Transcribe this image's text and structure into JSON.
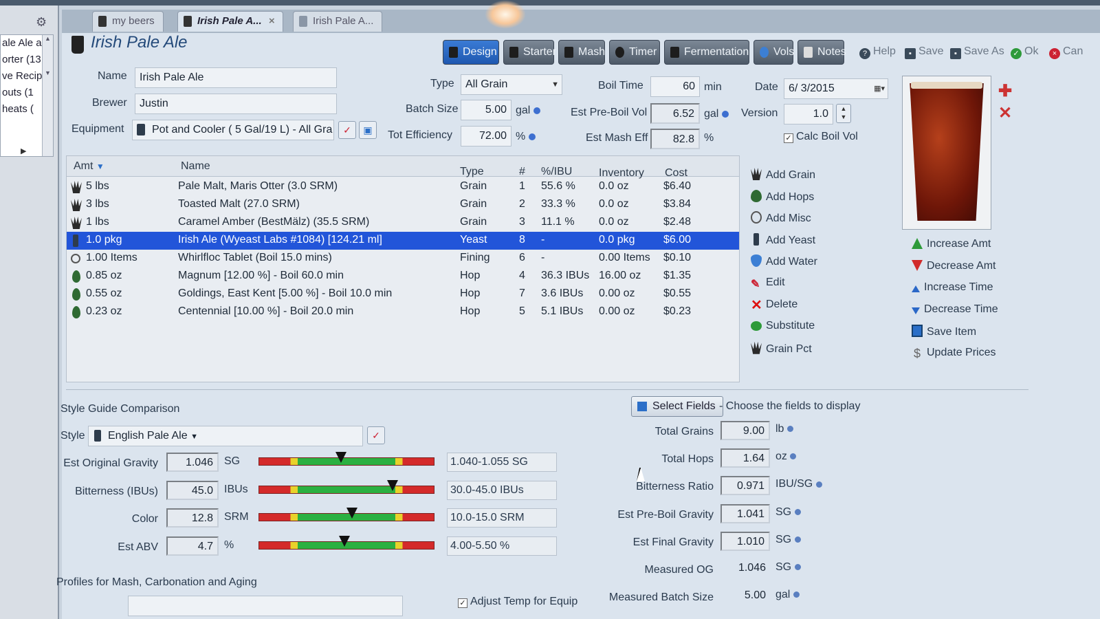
{
  "left_tree": {
    "items": [
      "ale Ale a",
      "orter (13",
      "ve Recip",
      "outs (1",
      "heats ("
    ]
  },
  "tabs": [
    {
      "label": "my beers",
      "active": false
    },
    {
      "label": "Irish Pale A...",
      "active": true,
      "close": "×"
    },
    {
      "label": "Irish Pale A...",
      "active": false
    }
  ],
  "title": "Irish Pale Ale",
  "toolbar": {
    "buttons": [
      "Design",
      "Starter",
      "Mash",
      "Timer",
      "Fermentation",
      "Vols",
      "Notes"
    ],
    "right": [
      "Help",
      "Save",
      "Save As",
      "Ok",
      "Can"
    ]
  },
  "recipe": {
    "name_label": "Name",
    "name": "Irish Pale Ale",
    "brewer_label": "Brewer",
    "brewer": "Justin",
    "equipment_label": "Equipment",
    "equipment": "Pot and Cooler ( 5 Gal/19 L) - All Gra",
    "type_label": "Type",
    "type": "All Grain",
    "batch_label": "Batch Size",
    "batch": "5.00",
    "batch_unit": "gal",
    "eff_label": "Tot Efficiency",
    "eff": "72.00",
    "eff_unit": "%",
    "boil_label": "Boil Time",
    "boil": "60",
    "boil_unit": "min",
    "preboil_label": "Est Pre-Boil Vol",
    "preboil": "6.52",
    "preboil_unit": "gal",
    "masheff_label": "Est Mash Eff",
    "masheff": "82.8",
    "masheff_unit": "%",
    "date_label": "Date",
    "date": "6/ 3/2015",
    "version_label": "Version",
    "version": "1.0",
    "calc_label": "Calc Boil Vol"
  },
  "table": {
    "headers": [
      "Amt",
      "Name",
      "Type",
      "#",
      "%/IBU",
      "Inventory",
      "Cost"
    ],
    "rows": [
      {
        "icon": "grain",
        "amt": "5 lbs",
        "name": "Pale Malt, Maris Otter (3.0 SRM)",
        "type": "Grain",
        "num": "1",
        "pct": "55.6 %",
        "inv": "0.0 oz",
        "cost": "$6.40"
      },
      {
        "icon": "grain",
        "amt": "3 lbs",
        "name": "Toasted Malt (27.0 SRM)",
        "type": "Grain",
        "num": "2",
        "pct": "33.3 %",
        "inv": "0.0 oz",
        "cost": "$3.84"
      },
      {
        "icon": "grain",
        "amt": "1 lbs",
        "name": "Caramel Amber (BestMälz) (35.5 SRM)",
        "type": "Grain",
        "num": "3",
        "pct": "11.1 %",
        "inv": "0.0 oz",
        "cost": "$2.48"
      },
      {
        "icon": "yeast",
        "amt": "1.0 pkg",
        "name": "Irish Ale (Wyeast Labs #1084) [124.21 ml]",
        "type": "Yeast",
        "num": "8",
        "pct": "-",
        "inv": "0.0 pkg",
        "cost": "$6.00",
        "selected": true
      },
      {
        "icon": "misc",
        "amt": "1.00 Items",
        "name": "Whirlfloc Tablet (Boil 15.0 mins)",
        "type": "Fining",
        "num": "6",
        "pct": "-",
        "inv": "0.00 Items",
        "cost": "$0.10"
      },
      {
        "icon": "hop",
        "amt": "0.85 oz",
        "name": "Magnum [12.00 %] - Boil 60.0 min",
        "type": "Hop",
        "num": "4",
        "pct": "36.3 IBUs",
        "inv": "16.00 oz",
        "cost": "$1.35"
      },
      {
        "icon": "hop",
        "amt": "0.55 oz",
        "name": "Goldings, East Kent [5.00 %] - Boil 10.0 min",
        "type": "Hop",
        "num": "7",
        "pct": "3.6 IBUs",
        "inv": "0.00 oz",
        "cost": "$0.55"
      },
      {
        "icon": "hop",
        "amt": "0.23 oz",
        "name": "Centennial [10.00 %] - Boil 20.0 min",
        "type": "Hop",
        "num": "5",
        "pct": "5.1 IBUs",
        "inv": "0.00 oz",
        "cost": "$0.23"
      }
    ]
  },
  "actions": [
    {
      "icon": "grain",
      "label": "Add Grain"
    },
    {
      "icon": "hop",
      "label": "Add Hops"
    },
    {
      "icon": "misc",
      "label": "Add Misc"
    },
    {
      "icon": "yeast",
      "label": "Add Yeast"
    },
    {
      "icon": "water",
      "label": "Add Water"
    },
    {
      "icon": "edit",
      "label": "Edit"
    },
    {
      "icon": "del",
      "label": "Delete"
    },
    {
      "icon": "sub",
      "label": "Substitute"
    },
    {
      "icon": "grain",
      "label": "Grain Pct"
    }
  ],
  "actions2": [
    {
      "icon": "up",
      "label": "Increase Amt"
    },
    {
      "icon": "down",
      "label": "Decrease Amt"
    },
    {
      "icon": "tup",
      "label": "Increase Time"
    },
    {
      "icon": "tdown",
      "label": "Decrease Time"
    },
    {
      "icon": "save",
      "label": "Save Item"
    },
    {
      "icon": "dollar",
      "label": "Update Prices"
    }
  ],
  "style": {
    "section": "Style Guide Comparison",
    "style_label": "Style",
    "style_value": "English Pale Ale",
    "rows": [
      {
        "label": "Est Original Gravity",
        "value": "1.046",
        "unit": "SG",
        "range": "1.040-1.055 SG",
        "level": 0.47
      },
      {
        "label": "Bitterness (IBUs)",
        "value": "45.0",
        "unit": "IBUs",
        "range": "30.0-45.0 IBUs",
        "level": 0.76
      },
      {
        "label": "Color",
        "value": "12.8",
        "unit": "SRM",
        "range": "10.0-15.0 SRM",
        "level": 0.53
      },
      {
        "label": "Est ABV",
        "value": "4.7",
        "unit": "%",
        "range": "4.00-5.50 %",
        "level": 0.49
      }
    ],
    "profiles": "Profiles for Mash, Carbonation and Aging",
    "adjust": "Adjust Temp for Equip"
  },
  "fields": {
    "select_button": "Select Fields",
    "select_hint": "- Choose the fields to display",
    "rows": [
      {
        "label": "Total Grains",
        "value": "9.00",
        "unit": "lb"
      },
      {
        "label": "Total Hops",
        "value": "1.64",
        "unit": "oz"
      },
      {
        "label": "Bitterness Ratio",
        "value": "0.971",
        "unit": "IBU/SG"
      },
      {
        "label": "Est Pre-Boil Gravity",
        "value": "1.041",
        "unit": "SG"
      },
      {
        "label": "Est Final Gravity",
        "value": "1.010",
        "unit": "SG"
      },
      {
        "label": "Measured OG",
        "value": "1.046",
        "unit": "SG"
      },
      {
        "label": "Measured Batch Size",
        "value": "5.00",
        "unit": "gal"
      }
    ]
  },
  "colors": {
    "selection": "#2255d9",
    "design_active": "#2a6ad0",
    "title": "#244a7a",
    "bar_green": "#2bb041",
    "bar_red": "#d42a2a",
    "bar_yellow": "#e8d22b"
  }
}
